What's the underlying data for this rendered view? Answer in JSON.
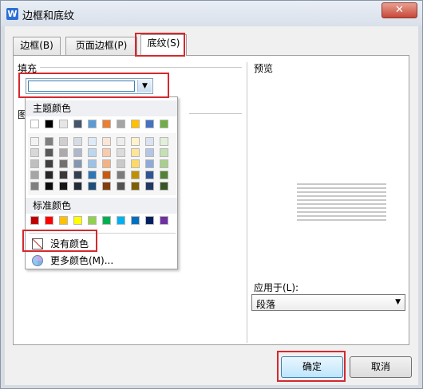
{
  "window": {
    "title": "边框和底纹",
    "close_glyph": "✕"
  },
  "tabs": [
    {
      "label": "边框(B)"
    },
    {
      "label": "页面边框(P)"
    },
    {
      "label": "底纹(S)"
    }
  ],
  "fill": {
    "label": "填充"
  },
  "pattern": {
    "label": "图"
  },
  "preview": {
    "label": "预览"
  },
  "apply": {
    "label": "应用于(L):",
    "value": "段落",
    "options": [
      "段落"
    ]
  },
  "color_picker": {
    "theme_title": "主题颜色",
    "standard_title": "标准颜色",
    "theme_top_row": [
      "#ffffff",
      "#000000",
      "#e7e6e6",
      "#44546a",
      "#5b9bd5",
      "#ed7d31",
      "#a5a5a5",
      "#ffc000",
      "#4472c4",
      "#70ad47"
    ],
    "theme_shades": [
      [
        "#f2f2f2",
        "#7f7f7f",
        "#d0cece",
        "#d6dce4",
        "#deebf6",
        "#fbe5d5",
        "#ededed",
        "#fff2cc",
        "#dae3f3",
        "#e2efd9"
      ],
      [
        "#d8d8d8",
        "#595959",
        "#aeaaaa",
        "#adb9ca",
        "#bdd7ee",
        "#f7cbac",
        "#dbdbdb",
        "#fee599",
        "#b4c6e7",
        "#c5e0b3"
      ],
      [
        "#bfbfbf",
        "#3f3f3f",
        "#757070",
        "#8496b0",
        "#9cc3e5",
        "#f4b183",
        "#c9c9c9",
        "#ffd965",
        "#8eaadb",
        "#a8d08d"
      ],
      [
        "#a5a5a5",
        "#262626",
        "#3a3838",
        "#323f4f",
        "#2e75b5",
        "#c55a11",
        "#7b7b7b",
        "#bf9000",
        "#2f5496",
        "#538135"
      ],
      [
        "#7f7f7f",
        "#0c0c0c",
        "#171616",
        "#222a35",
        "#1e4e79",
        "#833c0b",
        "#525252",
        "#7f6000",
        "#1f3864",
        "#375623"
      ]
    ],
    "standard_colors": [
      "#c00000",
      "#ff0000",
      "#ffc000",
      "#ffff00",
      "#92d050",
      "#00b050",
      "#00b0f0",
      "#0070c0",
      "#002060",
      "#7030a0"
    ],
    "no_color_label": "没有颜色",
    "more_colors_label": "更多颜色(M)..."
  },
  "buttons": {
    "ok": "确定",
    "cancel": "取消"
  },
  "highlight_color": "#d4292f"
}
